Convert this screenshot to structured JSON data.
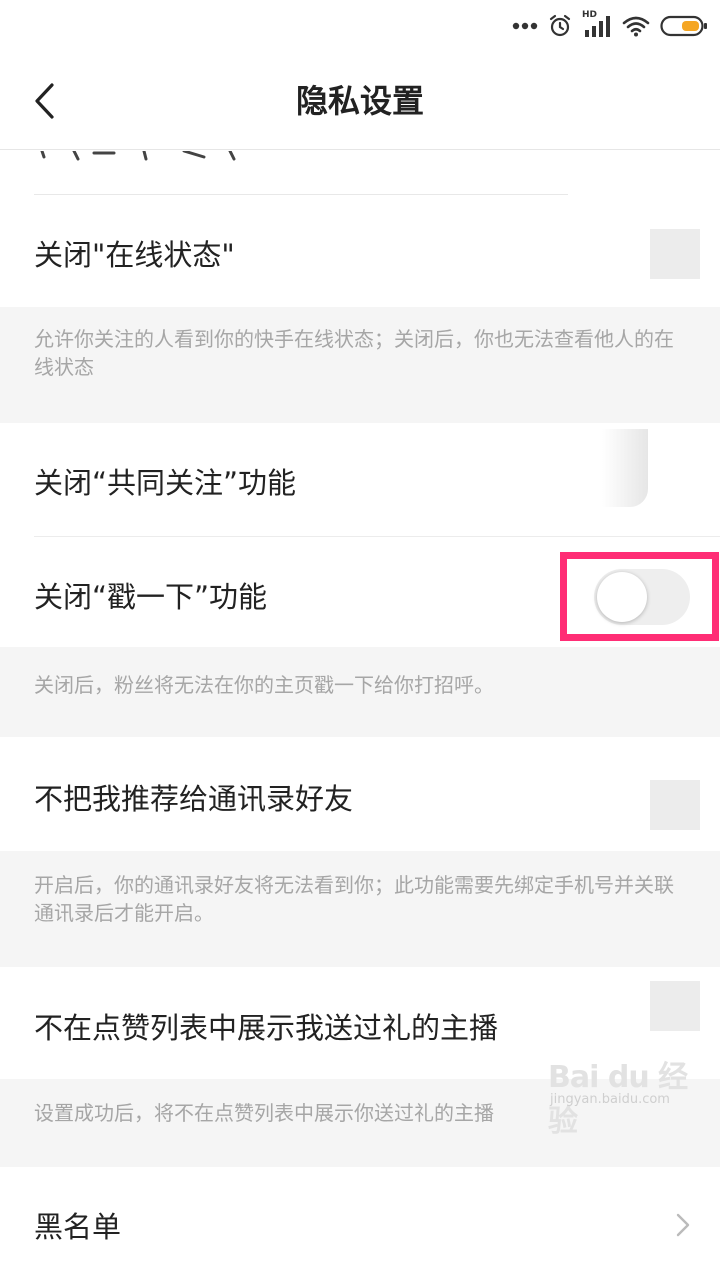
{
  "colors": {
    "highlight_border": "#ff2d75",
    "battery_fill": "#f5a623",
    "desc_bg": "#f5f5f5",
    "desc_text": "#a6a6a6",
    "toggle_off": "#eeeeee"
  },
  "status_bar": {
    "icons": [
      "more-dots-icon",
      "alarm-icon",
      "hd-signal-icon",
      "wifi-icon",
      "battery-icon"
    ],
    "hd_label": "HD"
  },
  "header": {
    "back_icon": "chevron-left-icon",
    "title": "隐私设置"
  },
  "settings": {
    "online_status": {
      "label": "关闭\"在线状态\"",
      "description": "允许你关注的人看到你的快手在线状态；关闭后，你也无法查看他人的在线状态"
    },
    "common_follow": {
      "label": "关闭“共同关注”功能"
    },
    "poke": {
      "label": "关闭“戳一下”功能",
      "toggle_on": false,
      "description": "关闭后，粉丝将无法在你的主页戳一下给你打招呼。"
    },
    "contacts_recommend": {
      "label": "不把我推荐给通讯录好友",
      "description": "开启后，你的通讯录好友将无法看到你；此功能需要先绑定手机号并关联通讯录后才能开启。"
    },
    "gift_hide": {
      "label": "不在点赞列表中展示我送过礼的主播",
      "description": "设置成功后，将不在点赞列表中展示你送过礼的主播"
    },
    "blacklist": {
      "label": "黑名单",
      "chevron_icon": "chevron-right-icon"
    }
  },
  "watermark": {
    "main": "Bai du 经验",
    "sub": "jingyan.baidu.com"
  }
}
